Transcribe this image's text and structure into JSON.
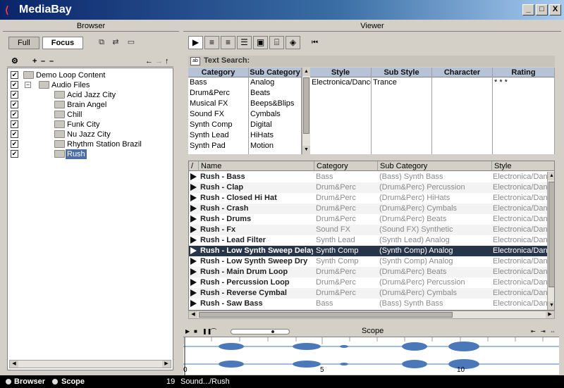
{
  "window": {
    "title": "MediaBay",
    "buttons": [
      "_",
      "□",
      "X"
    ]
  },
  "browser": {
    "header": "Browser",
    "tabs": [
      "Full",
      "Focus"
    ],
    "tree": [
      {
        "label": "Demo Loop Content",
        "checked": true,
        "level": 0
      },
      {
        "label": "Audio Files",
        "checked": true,
        "level": 1
      },
      {
        "label": "Acid Jazz City",
        "checked": true,
        "level": 2
      },
      {
        "label": "Brain Angel",
        "checked": true,
        "level": 2
      },
      {
        "label": "Chill",
        "checked": true,
        "level": 2
      },
      {
        "label": "Funk City",
        "checked": true,
        "level": 2
      },
      {
        "label": "Nu Jazz City",
        "checked": true,
        "level": 2
      },
      {
        "label": "Rhythm Station Brazil",
        "checked": true,
        "level": 2
      },
      {
        "label": "Rush",
        "checked": true,
        "level": 2,
        "selected": true
      }
    ]
  },
  "viewer": {
    "header": "Viewer",
    "text_search_label": "Text Search:",
    "filters": {
      "category": {
        "header": "Category",
        "items": [
          "Bass",
          "Drum&Perc",
          "Musical FX",
          "Sound FX",
          "Synth Comp",
          "Synth Lead",
          "Synth Pad"
        ]
      },
      "subcategory": {
        "header": "Sub Category",
        "items": [
          "Analog",
          "Beats",
          "Beeps&Blips",
          "Cymbals",
          "Digital",
          "HiHats",
          "Motion"
        ]
      },
      "style": {
        "header": "Style",
        "items": [
          "Electronica/Dance"
        ]
      },
      "substyle": {
        "header": "Sub Style",
        "items": [
          "Trance"
        ]
      },
      "character": {
        "header": "Character",
        "items": []
      },
      "rating": {
        "header": "Rating",
        "items": [
          "* * *"
        ]
      }
    },
    "results": {
      "columns": [
        "Name",
        "Category",
        "Sub Category",
        "Style"
      ],
      "sort_indicator": "/",
      "rows": [
        {
          "name": "Rush - Bass",
          "category": "Bass",
          "subcategory": "(Bass) Synth Bass",
          "style": "Electronica/Dance"
        },
        {
          "name": "Rush - Clap",
          "category": "Drum&Perc",
          "subcategory": "(Drum&Perc) Percussion",
          "style": "Electronica/Dance"
        },
        {
          "name": "Rush - Closed Hi Hat",
          "category": "Drum&Perc",
          "subcategory": "(Drum&Perc) HiHats",
          "style": "Electronica/Dance"
        },
        {
          "name": "Rush - Crash",
          "category": "Drum&Perc",
          "subcategory": "(Drum&Perc) Cymbals",
          "style": "Electronica/Dance"
        },
        {
          "name": "Rush - Drums",
          "category": "Drum&Perc",
          "subcategory": "(Drum&Perc) Beats",
          "style": "Electronica/Dance"
        },
        {
          "name": "Rush - Fx",
          "category": "Sound FX",
          "subcategory": "(Sound FX) Synthetic",
          "style": "Electronica/Dance"
        },
        {
          "name": "Rush - Lead Filter",
          "category": "Synth Lead",
          "subcategory": "(Synth Lead) Analog",
          "style": "Electronica/Dance"
        },
        {
          "name": "Rush - Low Synth Sweep Delay",
          "category": "Synth Comp",
          "subcategory": "(Synth Comp) Analog",
          "style": "Electronica/Dance",
          "selected": true
        },
        {
          "name": "Rush - Low Synth Sweep Dry",
          "category": "Synth Comp",
          "subcategory": "(Synth Comp) Analog",
          "style": "Electronica/Dance"
        },
        {
          "name": "Rush - Main Drum Loop",
          "category": "Drum&Perc",
          "subcategory": "(Drum&Perc) Beats",
          "style": "Electronica/Dance"
        },
        {
          "name": "Rush - Percussion Loop",
          "category": "Drum&Perc",
          "subcategory": "(Drum&Perc) Percussion",
          "style": "Electronica/Dance"
        },
        {
          "name": "Rush - Reverse Cymbal",
          "category": "Drum&Perc",
          "subcategory": "(Drum&Perc) Cymbals",
          "style": "Electronica/Dance"
        },
        {
          "name": "Rush - Saw Bass",
          "category": "Bass",
          "subcategory": "(Bass) Synth Bass",
          "style": "Electronica/Dance"
        }
      ]
    }
  },
  "scope": {
    "title": "Scope",
    "ruler": [
      "0",
      "5",
      "10"
    ],
    "wave_color": "#4a78b8"
  },
  "status": {
    "browser_label": "Browser",
    "scope_label": "Scope",
    "count": "19",
    "path": "Sound.../Rush"
  }
}
